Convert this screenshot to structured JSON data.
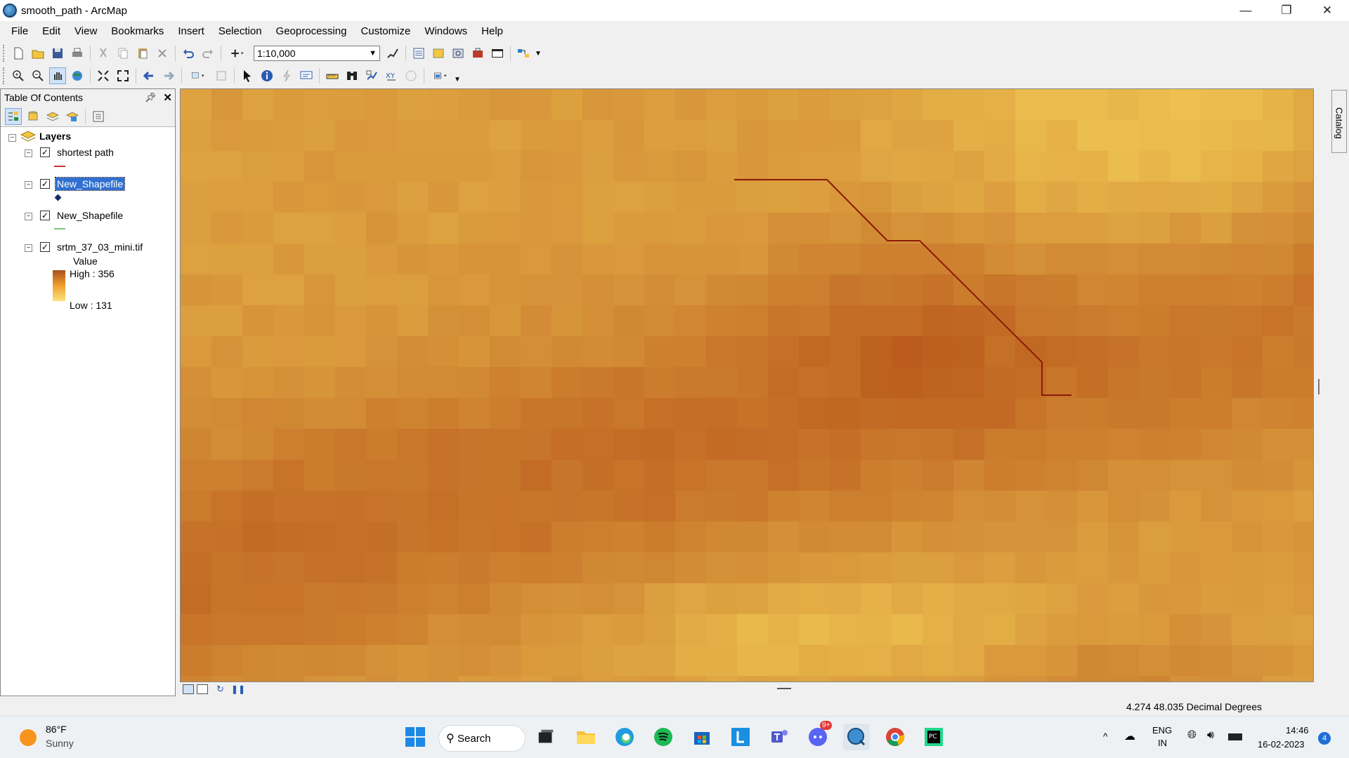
{
  "window": {
    "title": "smooth_path - ArcMap"
  },
  "menu": [
    "File",
    "Edit",
    "View",
    "Bookmarks",
    "Insert",
    "Selection",
    "Geoprocessing",
    "Customize",
    "Windows",
    "Help"
  ],
  "toolbar": {
    "scale": "1:10,000"
  },
  "toc": {
    "title": "Table Of Contents",
    "root": "Layers",
    "layers": [
      {
        "name": "shortest path",
        "checked": true,
        "symbol": "line-red"
      },
      {
        "name": "New_Shapefile",
        "checked": true,
        "symbol": "point-navy",
        "selected": true
      },
      {
        "name": "New_Shapefile",
        "checked": true,
        "symbol": "line-green"
      },
      {
        "name": "srtm_37_03_mini.tif",
        "checked": true,
        "symbol": "raster"
      }
    ],
    "raster_legend": {
      "field": "Value",
      "high": "High : 356",
      "low": "Low : 131"
    }
  },
  "catalog_tab": "Catalog",
  "status": {
    "coords": "4.274  48.035 Decimal Degrees"
  },
  "taskbar": {
    "weather_temp": "86°F",
    "weather_desc": "Sunny",
    "search": "Search",
    "lang1": "ENG",
    "lang2": "IN",
    "time": "14:46",
    "date": "16-02-2023",
    "notif": "4",
    "discord_badge": "9+"
  },
  "colors": {
    "high": "#b8561a",
    "low": "#f7d55a",
    "path": "#8b1a0a"
  }
}
